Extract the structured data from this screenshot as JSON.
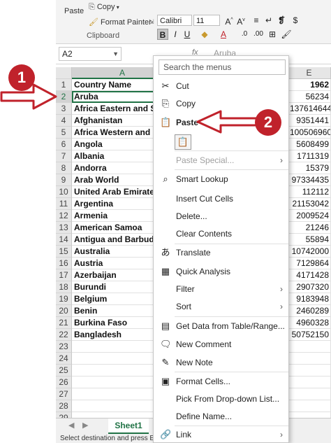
{
  "ribbon": {
    "paste_label": "Paste",
    "copy_label": "Copy",
    "format_painter_label": "Format Painter",
    "clipboard_group_label": "Clipboard",
    "font_name": "Calibri",
    "font_size": "11",
    "bold": "B",
    "italic": "I",
    "underline": "U",
    "font_color_glyph": "A"
  },
  "formula_bar": {
    "name_box": "A2",
    "fx": "fx",
    "value": "Aruba"
  },
  "columns": [
    "A",
    "E"
  ],
  "rows": [
    {
      "n": "1",
      "a": "Country Name",
      "e": "1962"
    },
    {
      "n": "2",
      "a": "Aruba",
      "e": "56234"
    },
    {
      "n": "3",
      "a": "Africa Eastern and Sou",
      "e": "137614644"
    },
    {
      "n": "4",
      "a": "Afghanistan",
      "e": "9351441"
    },
    {
      "n": "5",
      "a": "Africa Western and Ce",
      "e": "100506960"
    },
    {
      "n": "6",
      "a": "Angola",
      "e": "5608499"
    },
    {
      "n": "7",
      "a": "Albania",
      "e": "1711319"
    },
    {
      "n": "8",
      "a": "Andorra",
      "e": "15379"
    },
    {
      "n": "9",
      "a": "Arab World",
      "e": "97334435"
    },
    {
      "n": "10",
      "a": "United Arab Emirates",
      "e": "112112"
    },
    {
      "n": "11",
      "a": "Argentina",
      "e": "21153042"
    },
    {
      "n": "12",
      "a": "Armenia",
      "e": "2009524"
    },
    {
      "n": "13",
      "a": "American Samoa",
      "e": "21246"
    },
    {
      "n": "14",
      "a": "Antigua and Barbuda",
      "e": "55894"
    },
    {
      "n": "15",
      "a": "Australia",
      "e": "10742000"
    },
    {
      "n": "16",
      "a": "Austria",
      "e": "7129864"
    },
    {
      "n": "17",
      "a": "Azerbaijan",
      "e": "4171428"
    },
    {
      "n": "18",
      "a": "Burundi",
      "e": "2907320"
    },
    {
      "n": "19",
      "a": "Belgium",
      "e": "9183948"
    },
    {
      "n": "20",
      "a": "Benin",
      "e": "2460289"
    },
    {
      "n": "21",
      "a": "Burkina Faso",
      "e": "4960328"
    },
    {
      "n": "22",
      "a": "Bangladesh",
      "e": "50752150"
    },
    {
      "n": "23",
      "a": "",
      "e": ""
    },
    {
      "n": "24",
      "a": "",
      "e": ""
    },
    {
      "n": "25",
      "a": "",
      "e": ""
    },
    {
      "n": "26",
      "a": "",
      "e": ""
    },
    {
      "n": "27",
      "a": "",
      "e": ""
    },
    {
      "n": "28",
      "a": "",
      "e": ""
    },
    {
      "n": "29",
      "a": "",
      "e": ""
    }
  ],
  "sheet_tab": "Sheet1",
  "status_text": "Select destination and press ENTER",
  "context_menu": {
    "search_placeholder": "Search the menus",
    "items": [
      {
        "label": "Cut",
        "icon": "scissors-icon",
        "glyph": "✂"
      },
      {
        "label": "Copy",
        "icon": "copy-icon",
        "glyph": "⎘"
      },
      {
        "label": "Paste Options:",
        "icon": "paste-icon",
        "glyph": "📋"
      },
      {
        "label": "Paste Special...",
        "icon": "",
        "glyph": ""
      },
      {
        "label": "Smart Lookup",
        "icon": "search-icon",
        "glyph": "⌕"
      },
      {
        "label": "Insert Cut Cells",
        "icon": "",
        "glyph": ""
      },
      {
        "label": "Delete...",
        "icon": "",
        "glyph": ""
      },
      {
        "label": "Clear Contents",
        "icon": "",
        "glyph": ""
      },
      {
        "label": "Translate",
        "icon": "translate-icon",
        "glyph": "あ"
      },
      {
        "label": "Quick Analysis",
        "icon": "quick-analysis-icon",
        "glyph": "▦"
      },
      {
        "label": "Filter",
        "icon": "",
        "glyph": ""
      },
      {
        "label": "Sort",
        "icon": "",
        "glyph": ""
      },
      {
        "label": "Get Data from Table/Range...",
        "icon": "table-icon",
        "glyph": "▤"
      },
      {
        "label": "New Comment",
        "icon": "comment-icon",
        "glyph": "🗨"
      },
      {
        "label": "New Note",
        "icon": "note-icon",
        "glyph": "✎"
      },
      {
        "label": "Format Cells...",
        "icon": "format-cells-icon",
        "glyph": "▣"
      },
      {
        "label": "Pick From Drop-down List...",
        "icon": "",
        "glyph": ""
      },
      {
        "label": "Define Name...",
        "icon": "",
        "glyph": ""
      },
      {
        "label": "Link",
        "icon": "link-icon",
        "glyph": "🔗"
      }
    ],
    "arrow": "›"
  },
  "annotations": {
    "step1": "1",
    "step2": "2",
    "color": "#c0222b"
  }
}
